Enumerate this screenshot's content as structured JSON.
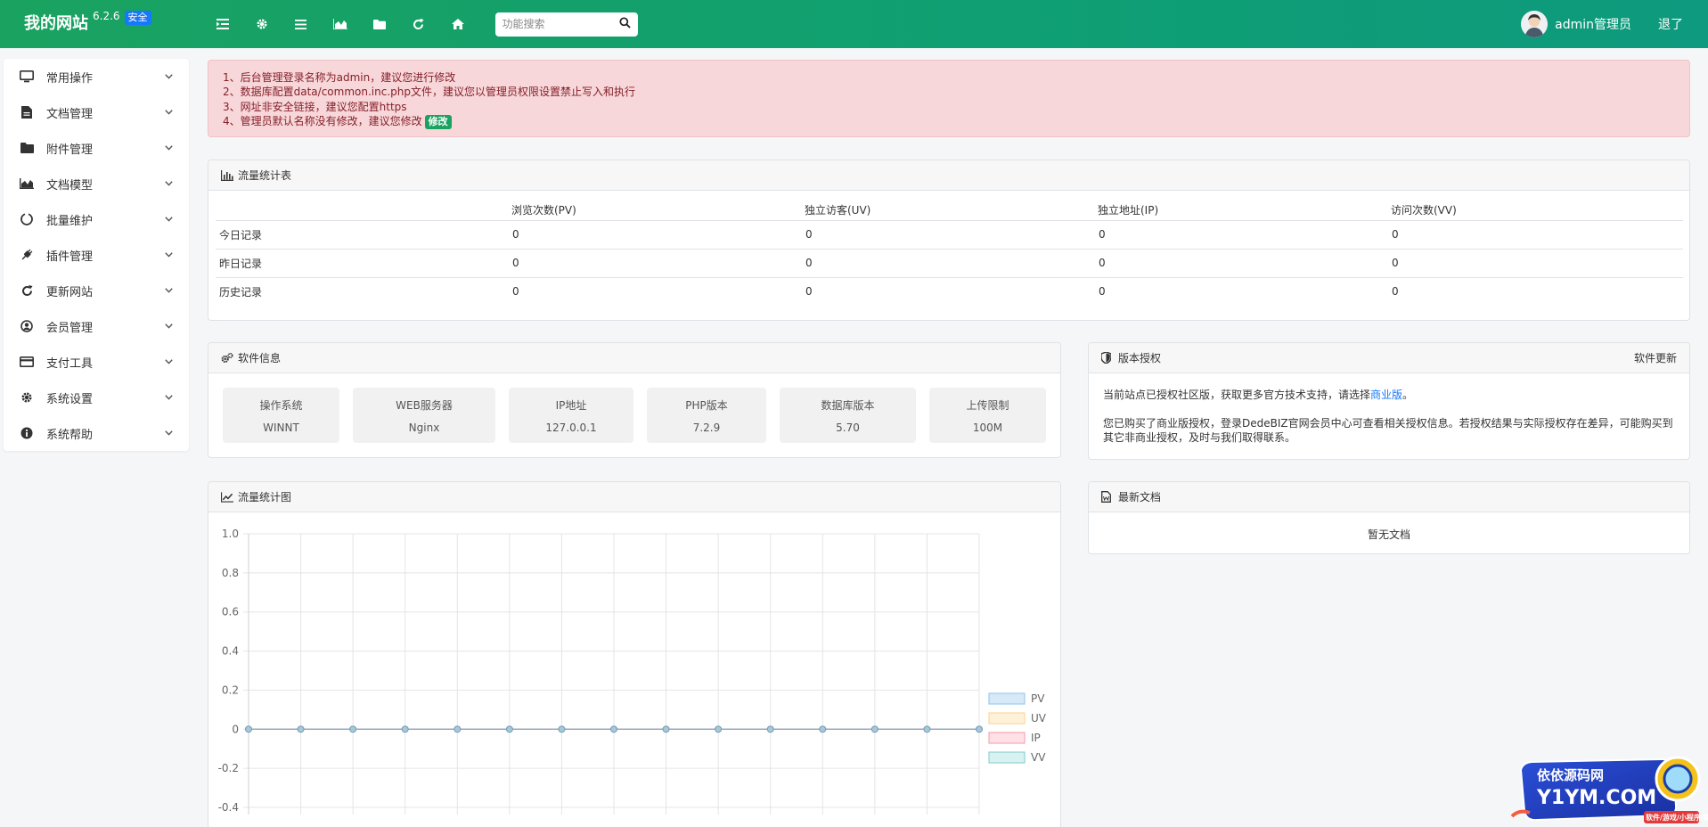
{
  "brand": {
    "name": "我的网站",
    "version": "6.2.6",
    "badge": "安全"
  },
  "topbar": {
    "icons": [
      "list-indent-icon",
      "gear-icon",
      "menu-icon",
      "area-chart-icon",
      "folder-icon",
      "refresh-icon",
      "home-icon"
    ],
    "search_placeholder": "功能搜索",
    "user_name": "admin管理员",
    "logout_label": "退了"
  },
  "sidebar": {
    "items": [
      {
        "label": "常用操作",
        "icon": "monitor-icon"
      },
      {
        "label": "文档管理",
        "icon": "file-icon"
      },
      {
        "label": "附件管理",
        "icon": "folder-icon"
      },
      {
        "label": "文档模型",
        "icon": "area-chart-icon"
      },
      {
        "label": "批量维护",
        "icon": "circle-notch-icon"
      },
      {
        "label": "插件管理",
        "icon": "plug-icon"
      },
      {
        "label": "更新网站",
        "icon": "refresh-icon"
      },
      {
        "label": "会员管理",
        "icon": "user-circle-icon"
      },
      {
        "label": "支付工具",
        "icon": "credit-card-icon"
      },
      {
        "label": "系统设置",
        "icon": "gear-icon"
      },
      {
        "label": "系统帮助",
        "icon": "info-icon"
      }
    ]
  },
  "alert": {
    "lines": [
      "1、后台管理登录名称为admin，建议您进行修改",
      "2、数据库配置data/common.inc.php文件，建议您以管理员权限设置禁止写入和执行",
      "3、网址非安全链接，建议您配置https",
      "4、管理员默认名称没有修改，建议您修改"
    ],
    "modify_label": "修改"
  },
  "traffic_table": {
    "title": "流量统计表",
    "columns": [
      "",
      "浏览次数(PV)",
      "独立访客(UV)",
      "独立地址(IP)",
      "访问次数(VV)"
    ],
    "rows": [
      {
        "label": "今日记录",
        "values": [
          "0",
          "0",
          "0",
          "0"
        ]
      },
      {
        "label": "昨日记录",
        "values": [
          "0",
          "0",
          "0",
          "0"
        ]
      },
      {
        "label": "历史记录",
        "values": [
          "0",
          "0",
          "0",
          "0"
        ]
      }
    ]
  },
  "software_info": {
    "title": "软件信息",
    "tiles": [
      {
        "label": "操作系统",
        "value": "WINNT"
      },
      {
        "label": "WEB服务器",
        "value": "Nginx"
      },
      {
        "label": "IP地址",
        "value": "127.0.0.1"
      },
      {
        "label": "PHP版本",
        "value": "7.2.9"
      },
      {
        "label": "数据库版本",
        "value": "5.70"
      },
      {
        "label": "上传限制",
        "value": "100M"
      }
    ]
  },
  "license": {
    "title": "版本授权",
    "update_label": "软件更新",
    "line1_prefix": "当前站点已授权社区版，获取更多官方技术支持，请选择",
    "line1_link": "商业版",
    "line1_suffix": "。",
    "line2": "您已购买了商业版授权，登录DedeBIZ官网会员中心可查看相关授权信息。若授权结果与实际授权存在差异，可能购买到其它非商业授权，及时与我们取得联系。"
  },
  "latest_docs": {
    "title": "最新文档",
    "empty_text": "暂无文档"
  },
  "traffic_chart": {
    "title": "流量统计图"
  },
  "chart_data": {
    "type": "line",
    "title": "",
    "xlabel": "",
    "ylabel": "",
    "ylim": [
      -0.4,
      1.0
    ],
    "yticks": [
      "1.0",
      "0.8",
      "0.6",
      "0.4",
      "0.2",
      "0",
      "-0.2",
      "-0.4"
    ],
    "point_count": 15,
    "grid": true,
    "legend_position": "right",
    "series": [
      {
        "name": "PV",
        "color": "#9ecbf0",
        "fill": "#d6e9f8",
        "values": [
          0,
          0,
          0,
          0,
          0,
          0,
          0,
          0,
          0,
          0,
          0,
          0,
          0,
          0,
          0
        ]
      },
      {
        "name": "UV",
        "color": "#fdd89c",
        "fill": "#fff1d9",
        "values": [
          0,
          0,
          0,
          0,
          0,
          0,
          0,
          0,
          0,
          0,
          0,
          0,
          0,
          0,
          0
        ]
      },
      {
        "name": "IP",
        "color": "#f7a6b4",
        "fill": "#fde1e6",
        "values": [
          0,
          0,
          0,
          0,
          0,
          0,
          0,
          0,
          0,
          0,
          0,
          0,
          0,
          0,
          0
        ]
      },
      {
        "name": "VV",
        "color": "#8fd3d3",
        "fill": "#d9f1f1",
        "values": [
          0,
          0,
          0,
          0,
          0,
          0,
          0,
          0,
          0,
          0,
          0,
          0,
          0,
          0,
          0
        ]
      }
    ]
  },
  "watermark": {
    "line1": "依依源码网",
    "line2": "Y1YM.COM",
    "line3": "软件/游戏/小程序/棋牌"
  },
  "colors": {
    "topbar": "#1aa260",
    "accent": "#1677ff",
    "alert_bg": "#f8d7da",
    "alert_text": "#842029"
  }
}
